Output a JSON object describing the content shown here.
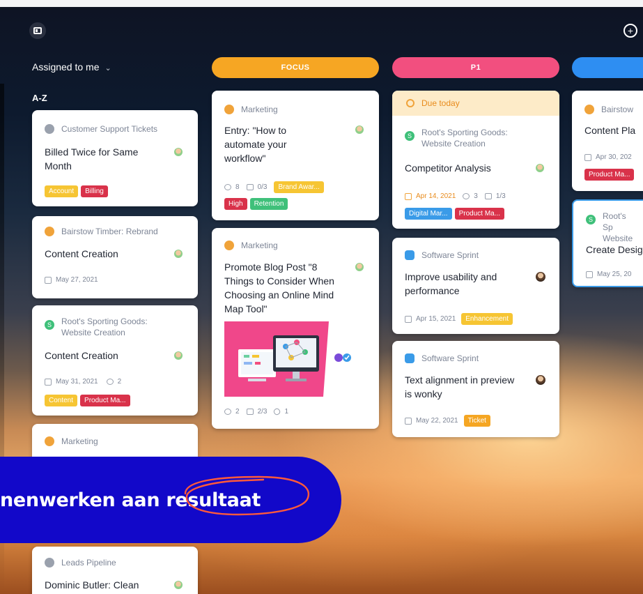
{
  "toolbar": {
    "layout_icon": "layout-icon",
    "add_icon": "plus-circle-icon"
  },
  "filter": {
    "label": "Assigned to me",
    "chevron": "⌄"
  },
  "sort": {
    "label": "A-Z"
  },
  "columns": [
    {
      "label": "FOCUS",
      "color": "#f6a623"
    },
    {
      "label": "P1",
      "color": "#f24f7f"
    },
    {
      "label": "",
      "color": "#2e8ef2"
    }
  ],
  "col0": {
    "c1": {
      "project": "Customer Support Tickets",
      "title": "Billed Twice for Same Month",
      "tags": [
        "Account",
        "Billing"
      ]
    },
    "c2": {
      "project": "Bairstow Timber: Rebrand",
      "title": "Content Creation",
      "date": "May 27, 2021"
    },
    "c3": {
      "project": "Root's Sporting Goods: Website Creation",
      "project_badge": "S",
      "title": "Content Creation",
      "date": "May 31, 2021",
      "comments": "2",
      "tags": [
        "Content",
        "Product Ma..."
      ]
    },
    "c4": {
      "project": "Marketing"
    },
    "c5": {
      "project": "Leads Pipeline",
      "title": "Dominic Butler: Clean"
    }
  },
  "col1": {
    "c1": {
      "project": "Marketing",
      "title": "Entry: \"How to automate your workflow\"",
      "comments": "8",
      "checklist": "0/3",
      "tags": [
        "Brand Awar...",
        "High",
        "Retention"
      ]
    },
    "c2": {
      "project": "Marketing",
      "title": "Promote Blog Post \"8 Things to Consider When Choosing an Online Mind Map Tool\"",
      "comments": "2",
      "checklist": "2/3",
      "attachments": "1"
    }
  },
  "col2": {
    "c1": {
      "due": "Due today",
      "project": "Root's Sporting Goods: Website Creation",
      "project_badge": "S",
      "title": "Competitor Analysis",
      "date": "Apr 14, 2021",
      "comments": "3",
      "checklist": "1/3",
      "tags": [
        "Digital Mar...",
        "Product Ma..."
      ]
    },
    "c2": {
      "project": "Software Sprint",
      "title": "Improve usability and performance",
      "date": "Apr 15, 2021",
      "tags": [
        "Enhancement"
      ]
    },
    "c3": {
      "project": "Software Sprint",
      "title": "Text alignment in preview is wonky",
      "date": "May 22, 2021",
      "tags": [
        "Ticket"
      ]
    }
  },
  "col3": {
    "c1": {
      "project": "Bairstow",
      "title": "Content Pla",
      "date": "Apr 30, 202",
      "tags": [
        "Product Ma..."
      ]
    },
    "c2": {
      "project": "Root's Sp Website",
      "project_badge": "S",
      "title": "Create Desig",
      "date": "May 25, 20"
    }
  },
  "banner": {
    "text": "nenwerken aan resultaat"
  },
  "colors": {
    "yellow": "#f6c533",
    "red": "#d9324a",
    "green": "#3fc07a",
    "blue": "#3a9be8",
    "orange": "#f5a623"
  }
}
